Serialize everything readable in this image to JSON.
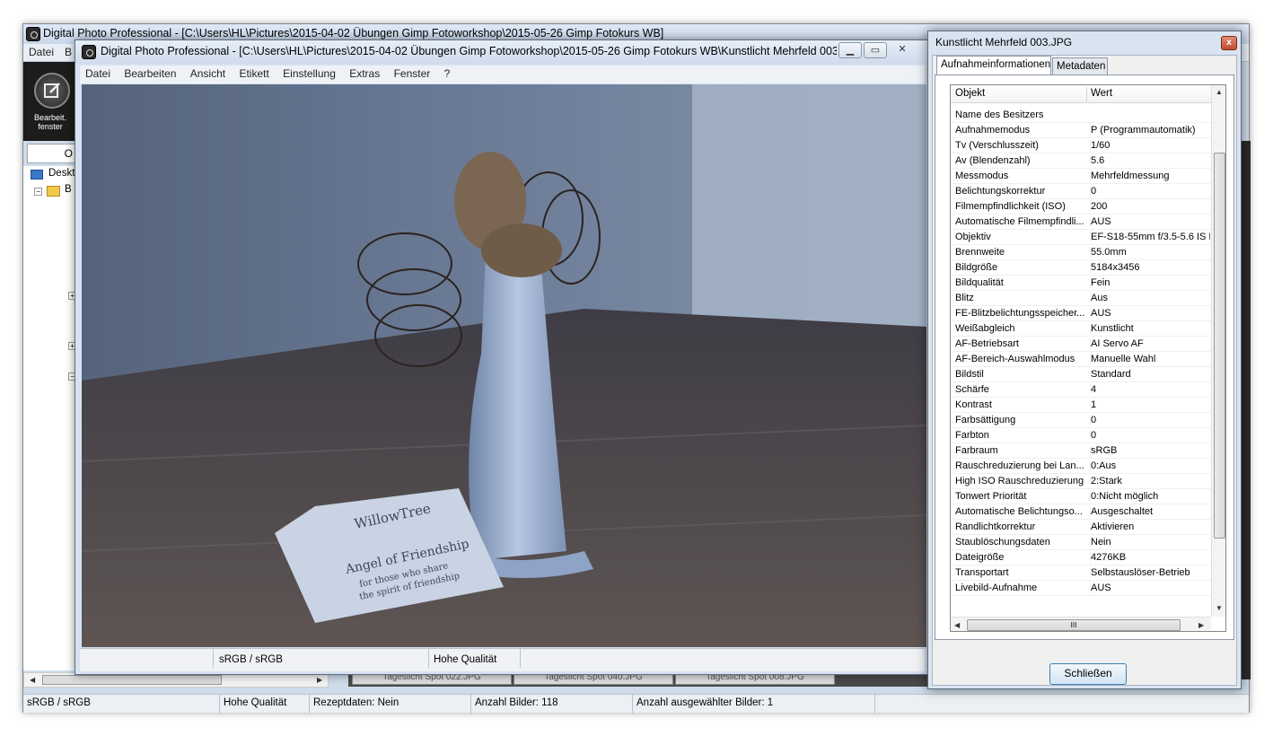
{
  "background_window": {
    "title": "Digital Photo Professional - [C:\\Users\\HL\\Pictures\\2015-04-02 Übungen  Gimp Fotoworkshop\\2015-05-26 Gimp Fotokurs WB]",
    "menu": [
      "Datei",
      "B"
    ],
    "edit_button_label": "Bearbeit. fenster",
    "tree": {
      "desktop_label": "Deskt",
      "folder_label": "B"
    },
    "tab_letter": "O",
    "thumbnails": [
      "Tageslicht Spot 022.JPG",
      "Tageslicht Spot 040.JPG",
      "Tageslicht Spot 008.JPG"
    ],
    "status": {
      "color_space": "sRGB / sRGB",
      "quality": "Hohe Qualität",
      "recipe": "Rezeptdaten: Nein",
      "image_count": "Anzahl Bilder: 118",
      "selected_count": "Anzahl ausgewählter Bilder: 1"
    }
  },
  "viewer": {
    "title": "Digital Photo Professional - [C:\\Users\\HL\\Pictures\\2015-04-02 Übungen  Gimp Fotoworkshop\\2015-05-26 Gimp Fotokurs WB\\Kunstlicht Mehrfeld 003.JP...",
    "menu": [
      "Datei",
      "Bearbeiten",
      "Ansicht",
      "Etikett",
      "Einstellung",
      "Extras",
      "Fenster",
      "?"
    ],
    "status_color_space": "sRGB / sRGB",
    "status_quality": "Hohe Qualität",
    "photo": {
      "card_line1": "WillowTree",
      "card_line2": "Angel of Friendship",
      "card_line3": "for those who share",
      "card_line4": "the spirit of friendship"
    }
  },
  "dialog": {
    "title": "Kunstlicht Mehrfeld 003.JPG",
    "close_glyph": "x",
    "tabs": [
      "Aufnahmeinformationen",
      "Metadaten"
    ],
    "columns": [
      "Objekt",
      "Wert"
    ],
    "rows": [
      {
        "k": "Name des Besitzers",
        "v": ""
      },
      {
        "k": "Aufnahmemodus",
        "v": "P (Programmautomatik)"
      },
      {
        "k": "Tv (Verschlusszeit)",
        "v": "1/60"
      },
      {
        "k": "Av (Blendenzahl)",
        "v": "5.6"
      },
      {
        "k": "Messmodus",
        "v": "Mehrfeldmessung"
      },
      {
        "k": "Belichtungskorrektur",
        "v": "0"
      },
      {
        "k": "Filmempfindlichkeit (ISO)",
        "v": "200"
      },
      {
        "k": "Automatische Filmempfindli...",
        "v": "AUS"
      },
      {
        "k": "Objektiv",
        "v": "EF-S18-55mm f/3.5-5.6 IS I"
      },
      {
        "k": "Brennweite",
        "v": "55.0mm"
      },
      {
        "k": "Bildgröße",
        "v": "5184x3456"
      },
      {
        "k": "Bildqualität",
        "v": "Fein"
      },
      {
        "k": "Blitz",
        "v": "Aus"
      },
      {
        "k": "FE-Blitzbelichtungsspeicher...",
        "v": "AUS"
      },
      {
        "k": "Weißabgleich",
        "v": "Kunstlicht"
      },
      {
        "k": "AF-Betriebsart",
        "v": "AI Servo AF"
      },
      {
        "k": "AF-Bereich-Auswahlmodus",
        "v": "Manuelle  Wahl"
      },
      {
        "k": "Bildstil",
        "v": "Standard"
      },
      {
        "k": "Schärfe",
        "v": "4"
      },
      {
        "k": "Kontrast",
        "v": "1"
      },
      {
        "k": "Farbsättigung",
        "v": "0"
      },
      {
        "k": "Farbton",
        "v": "0"
      },
      {
        "k": "Farbraum",
        "v": "sRGB"
      },
      {
        "k": "Rauschreduzierung bei Lan...",
        "v": "0:Aus"
      },
      {
        "k": "High ISO Rauschreduzierung",
        "v": "2:Stark"
      },
      {
        "k": "Tonwert Priorität",
        "v": "0:Nicht möglich"
      },
      {
        "k": "Automatische Belichtungso...",
        "v": "Ausgeschaltet"
      },
      {
        "k": "Randlichtkorrektur",
        "v": "Aktivieren"
      },
      {
        "k": "Staublöschungsdaten",
        "v": "Nein"
      },
      {
        "k": "Dateigröße",
        "v": "4276KB"
      },
      {
        "k": "Transportart",
        "v": "Selbstauslöser-Betrieb"
      },
      {
        "k": "Livebild-Aufnahme",
        "v": "AUS"
      }
    ],
    "hscroll_grip": "III",
    "close_button": "Schließen"
  }
}
